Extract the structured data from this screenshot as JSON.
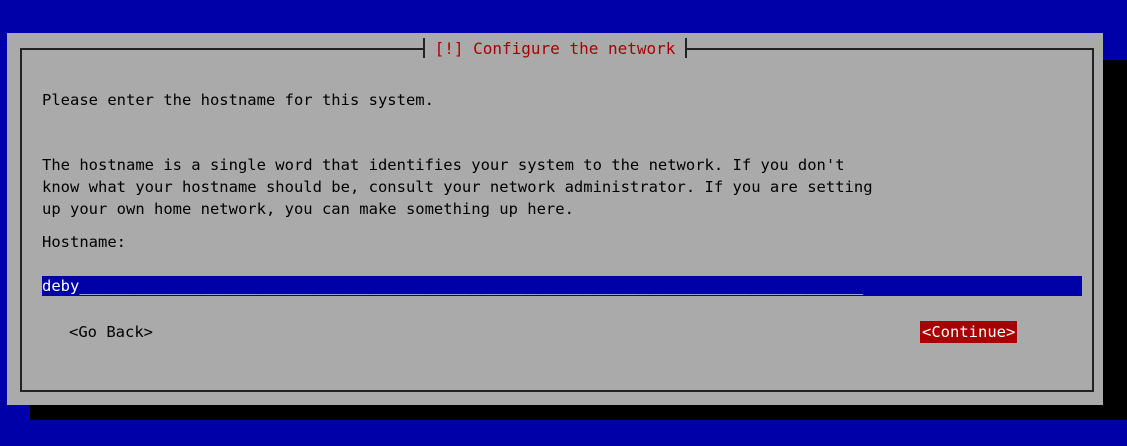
{
  "dialog": {
    "title": "[!] Configure the network",
    "prompt": "Please enter the hostname for this system.",
    "description": "The hostname is a single word that identifies your system to the network. If you don't\nknow what your hostname should be, consult your network administrator. If you are setting\nup your own home network, you can make something up here.",
    "field_label": "Hostname:",
    "hostname_value": "deby",
    "hostname_fill": "____________________________________________________________________________________"
  },
  "buttons": {
    "back_label": "<Go Back>",
    "continue_label": "<Continue>"
  },
  "colors": {
    "screen_background": "#0000a8",
    "dialog_background": "#aaaaaa",
    "title_text": "#a80000",
    "input_background": "#0000a8",
    "focused_button_background": "#a80000",
    "shadow": "#000000"
  }
}
